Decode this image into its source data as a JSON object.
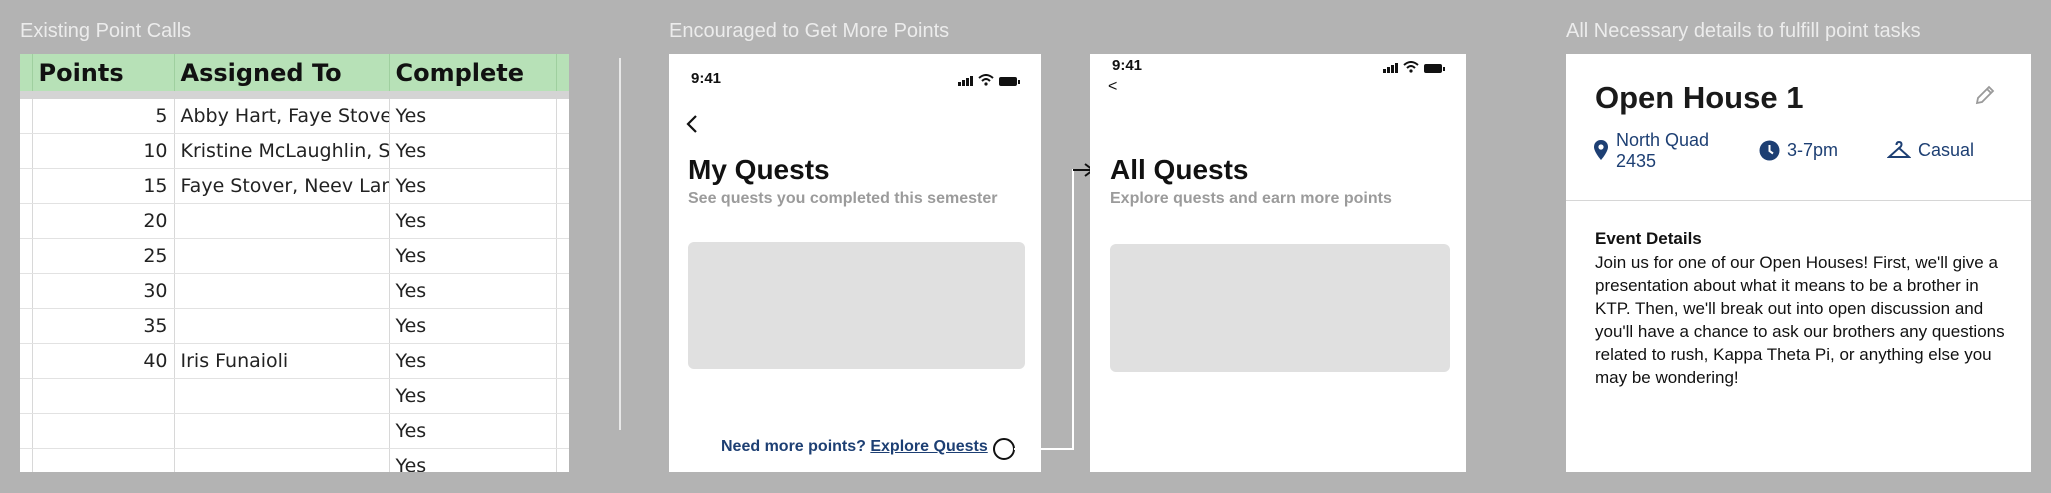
{
  "labels": {
    "section1": "Existing Point Calls",
    "section2": "Encouraged to Get More Points",
    "section3": "All Necessary details to fulfill point tasks"
  },
  "sheet": {
    "headers": [
      "Points",
      "Assigned To",
      "Complete"
    ],
    "rows": [
      [
        "5",
        "Abby Hart, Faye Stover,",
        "Yes"
      ],
      [
        "10",
        "Kristine McLaughlin, Sa",
        "Yes"
      ],
      [
        "15",
        "Faye Stover, Neev Lamb",
        "Yes"
      ],
      [
        "20",
        "",
        "Yes"
      ],
      [
        "25",
        "",
        "Yes"
      ],
      [
        "30",
        "",
        "Yes"
      ],
      [
        "35",
        "",
        "Yes"
      ],
      [
        "40",
        "Iris Funaioli",
        "Yes"
      ],
      [
        "",
        "",
        "Yes"
      ],
      [
        "",
        "",
        "Yes"
      ],
      [
        "",
        "",
        "Yes"
      ]
    ],
    "header_color": "#b7e1b7"
  },
  "phone1": {
    "time": "9:41",
    "back_icon": "chevron-left-icon",
    "title": "My Quests",
    "subtitle": "See quests you completed this semester",
    "cta_text": "Need more points?",
    "cta_link": "Explore Quests"
  },
  "phone2": {
    "time": "9:41",
    "back_glyph": "<",
    "title": "All Quests",
    "subtitle": "Explore quests and earn more points"
  },
  "details": {
    "title": "Open House 1",
    "location": [
      "North Quad",
      "2435"
    ],
    "time": "3-7pm",
    "dress": "Casual",
    "event_heading": "Event Details",
    "event_body": "Join us for one of our Open Houses! First, we'll give a presentation about what it means to be a brother in KTP. Then, we'll break out into open discussion and you'll have a chance to ask our brothers any questions related to rush, Kappa Theta Pi, or anything else you may be wondering!",
    "accent": "#1d3f73"
  }
}
